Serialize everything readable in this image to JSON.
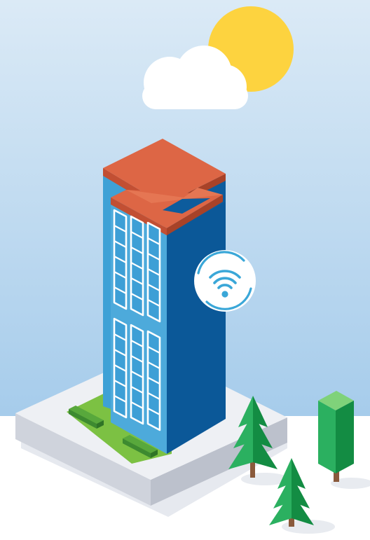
{
  "scene": {
    "subject": "isometric-office-building-with-wifi",
    "colors": {
      "sky_top": "#d9e9f6",
      "sky_bottom": "#a8cdec",
      "ground": "#ffffff",
      "sun": "#fdd33f",
      "cloud": "#ffffff",
      "roof": "#dd6645",
      "wall_light": "#4daadb",
      "wall_dark": "#0d5c9d",
      "window_frame": "#ffffff",
      "window_glass": "#3d9fd6",
      "wifi_ring": "#3aa7d8",
      "lawn": "#7cc143",
      "hedge": "#4a9b37",
      "tree_light": "#2bb060",
      "tree_dark": "#138c43",
      "trunk": "#8a5a3c",
      "base_top": "#eef0f4",
      "base_side": "#cfd3dc"
    },
    "icons": [
      "sun-icon",
      "cloud-icon",
      "wifi-icon",
      "pine-tree-icon",
      "column-tree-icon"
    ]
  }
}
